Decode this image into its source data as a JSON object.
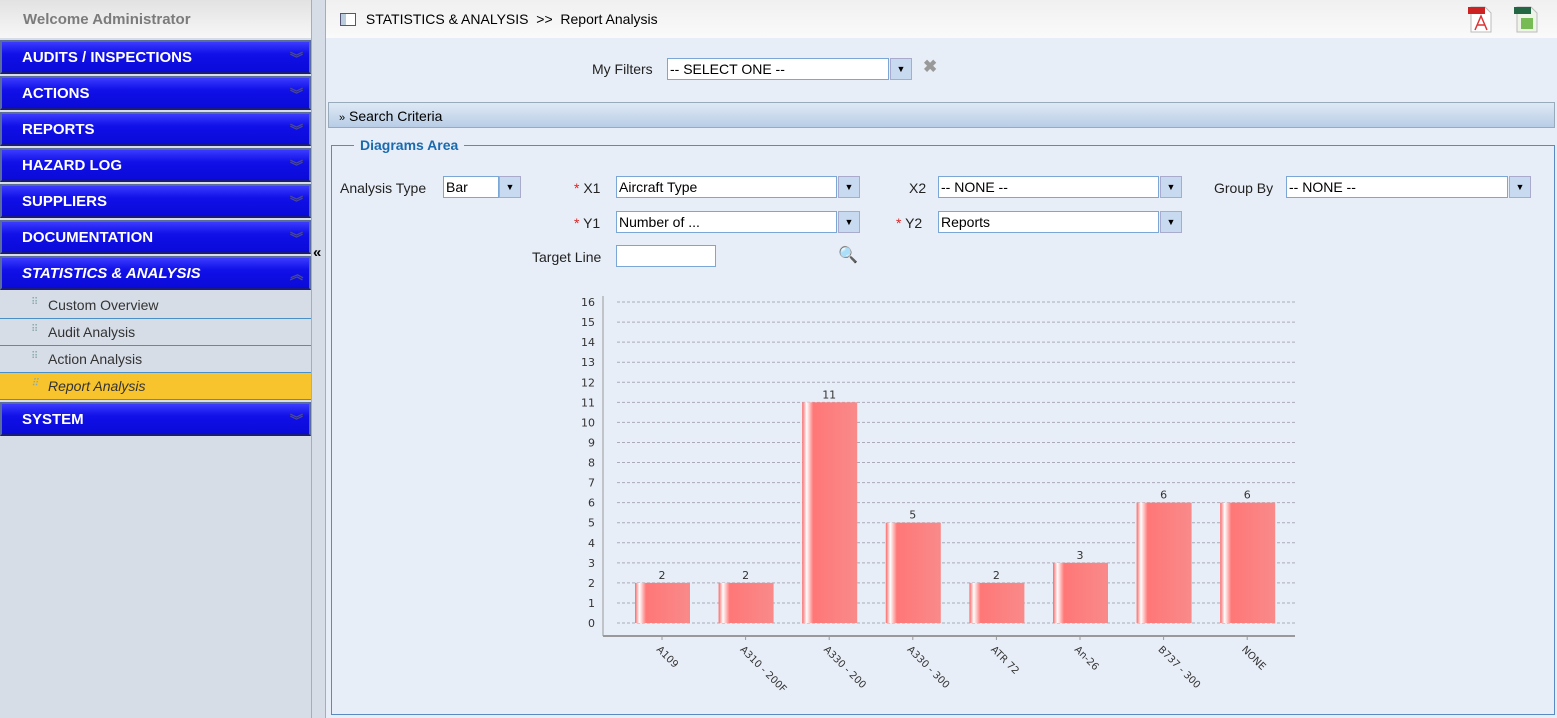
{
  "sidebar": {
    "welcome": "Welcome  Administrator",
    "menus": [
      "AUDITS / INSPECTIONS",
      "ACTIONS",
      "REPORTS",
      "HAZARD LOG",
      "SUPPLIERS",
      "DOCUMENTATION",
      "STATISTICS & ANALYSIS"
    ],
    "sub_items": [
      "Custom Overview",
      "Audit Analysis",
      "Action Analysis",
      "Report Analysis"
    ],
    "last_menu": "SYSTEM",
    "active_sub": "Report Analysis"
  },
  "header": {
    "breadcrumb": "STATISTICS & ANALYSIS  >>  Report Analysis",
    "icons": [
      "pdf-export-icon",
      "xls-export-icon"
    ]
  },
  "filters": {
    "label": "My Filters",
    "value": "-- SELECT ONE --"
  },
  "search_criteria": "Search Criteria",
  "diagrams": {
    "legend": "Diagrams Area",
    "analysis_type_label": "Analysis Type",
    "analysis_type": "Bar",
    "x1_label": "X1",
    "x1": "Aircraft Type",
    "x2_label": "X2",
    "x2": "-- NONE --",
    "group_by_label": "Group By",
    "group_by": "-- NONE --",
    "y1_label": "Y1",
    "y1": "Number of ...",
    "y2_label": "Y2",
    "y2": "Reports",
    "target_line_label": "Target Line",
    "target_line": ""
  },
  "chart_data": {
    "type": "bar",
    "categories": [
      "A109",
      "A310 - 200F",
      "A330 - 200",
      "A330 - 300",
      "ATR 72",
      "An-26",
      "B737 - 300",
      "NONE"
    ],
    "values": [
      2,
      2,
      11,
      5,
      2,
      3,
      6,
      6
    ],
    "ylim": [
      0,
      16
    ],
    "yticks": [
      0,
      1,
      2,
      3,
      4,
      5,
      6,
      7,
      8,
      9,
      10,
      11,
      12,
      13,
      14,
      15,
      16
    ],
    "grid": true,
    "bar_color": "#f87070",
    "data_labels": true
  }
}
